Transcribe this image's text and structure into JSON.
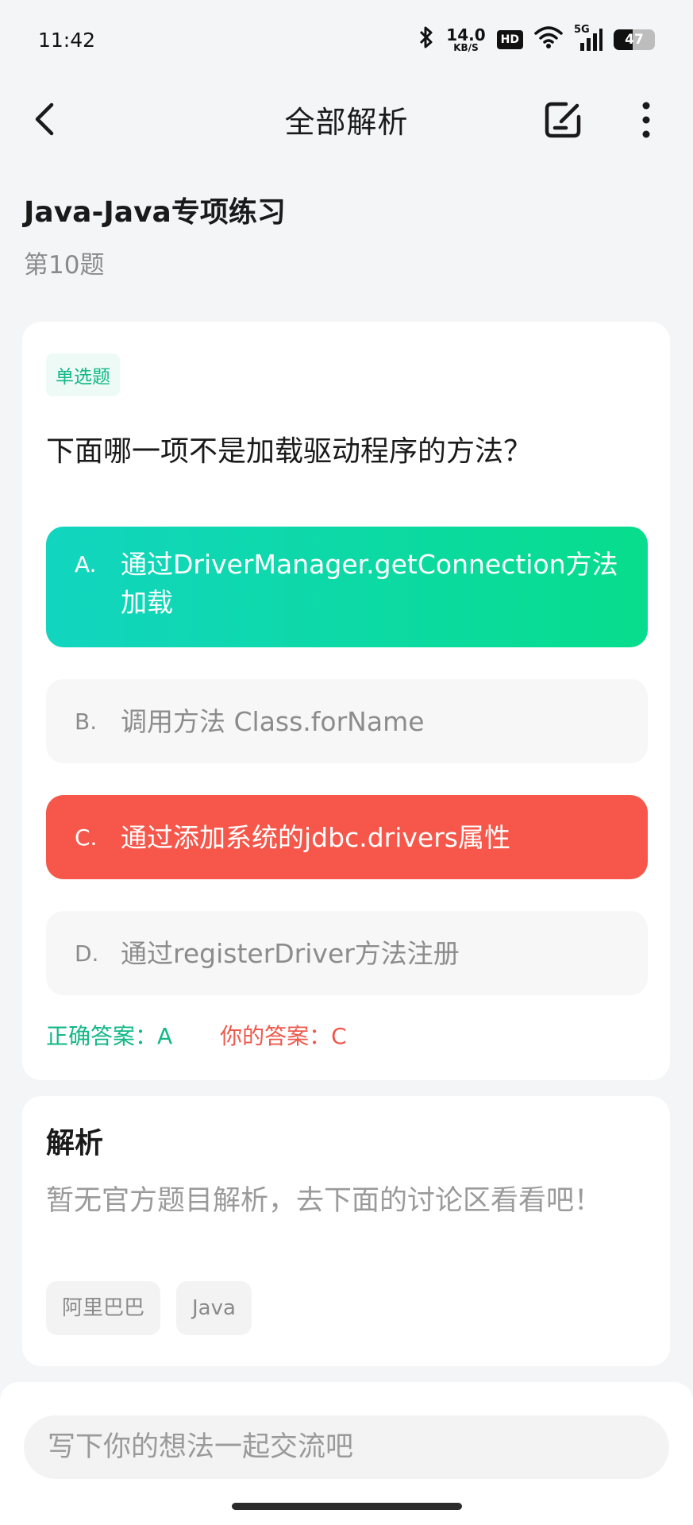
{
  "status_bar": {
    "time": "11:42",
    "net_speed_value": "14.0",
    "net_speed_unit": "KB/S",
    "hd_label": "HD",
    "network_label": "5G",
    "battery_level": "47",
    "battery_fraction": 0.47,
    "icons": [
      "bluetooth-icon",
      "wifi-icon",
      "cellular-signal-icon",
      "battery-icon"
    ]
  },
  "header": {
    "title": "全部解析",
    "icons": [
      "back-arrow-icon",
      "note-edit-icon",
      "more-vertical-icon"
    ]
  },
  "practice": {
    "title": "Java-Java专项练习",
    "question_number": "第10题"
  },
  "question": {
    "type_tag": "单选题",
    "text": "下面哪一项不是加载驱动程序的方法？",
    "options": [
      {
        "letter": "A.",
        "text": "通过DriverManager.getConnection方法加载",
        "state": "correct"
      },
      {
        "letter": "B.",
        "text": "调用方法 Class.forName",
        "state": "normal"
      },
      {
        "letter": "C.",
        "text": "通过添加系统的jdbc.drivers属性",
        "state": "wrong"
      },
      {
        "letter": "D.",
        "text": "通过registerDriver方法注册",
        "state": "normal"
      }
    ],
    "correct_answer": "正确答案：A",
    "your_answer": "你的答案：C"
  },
  "analysis": {
    "heading": "解析",
    "text": "暂无官方题目解析，去下面的讨论区看看吧！",
    "tags": [
      "阿里巴巴",
      "Java"
    ]
  },
  "comment": {
    "placeholder": "写下你的想法一起交流吧"
  },
  "colors": {
    "correct_gradient_start": "#12d5c0",
    "correct_gradient_end": "#07dd8c",
    "wrong": "#f6574a",
    "accent_green": "#12b886",
    "accent_red": "#f0584b"
  }
}
